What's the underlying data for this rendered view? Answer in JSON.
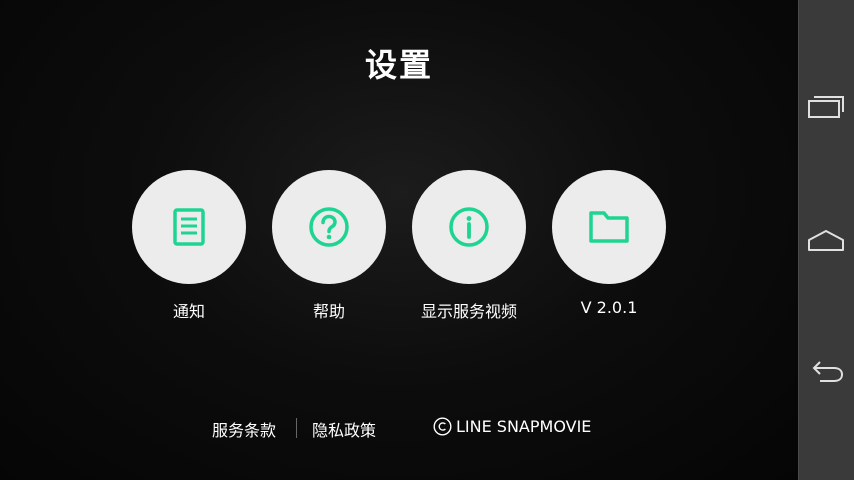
{
  "header": {
    "title": "设置"
  },
  "menu": {
    "items": [
      {
        "label": "通知",
        "icon": "document-icon"
      },
      {
        "label": "帮助",
        "icon": "question-icon"
      },
      {
        "label": "显示服务视频",
        "icon": "info-icon"
      },
      {
        "label": "V 2.0.1",
        "icon": "folder-icon"
      }
    ]
  },
  "footer": {
    "terms": "服务条款",
    "privacy": "隐私政策",
    "copyright": "LINE SNAPMOVIE"
  },
  "navbar": {
    "icons": [
      "recent-apps-icon",
      "home-icon",
      "back-icon"
    ]
  },
  "colors": {
    "accent": "#1ed491",
    "circle": "#ececec",
    "navbar": "#3a3a3a"
  }
}
